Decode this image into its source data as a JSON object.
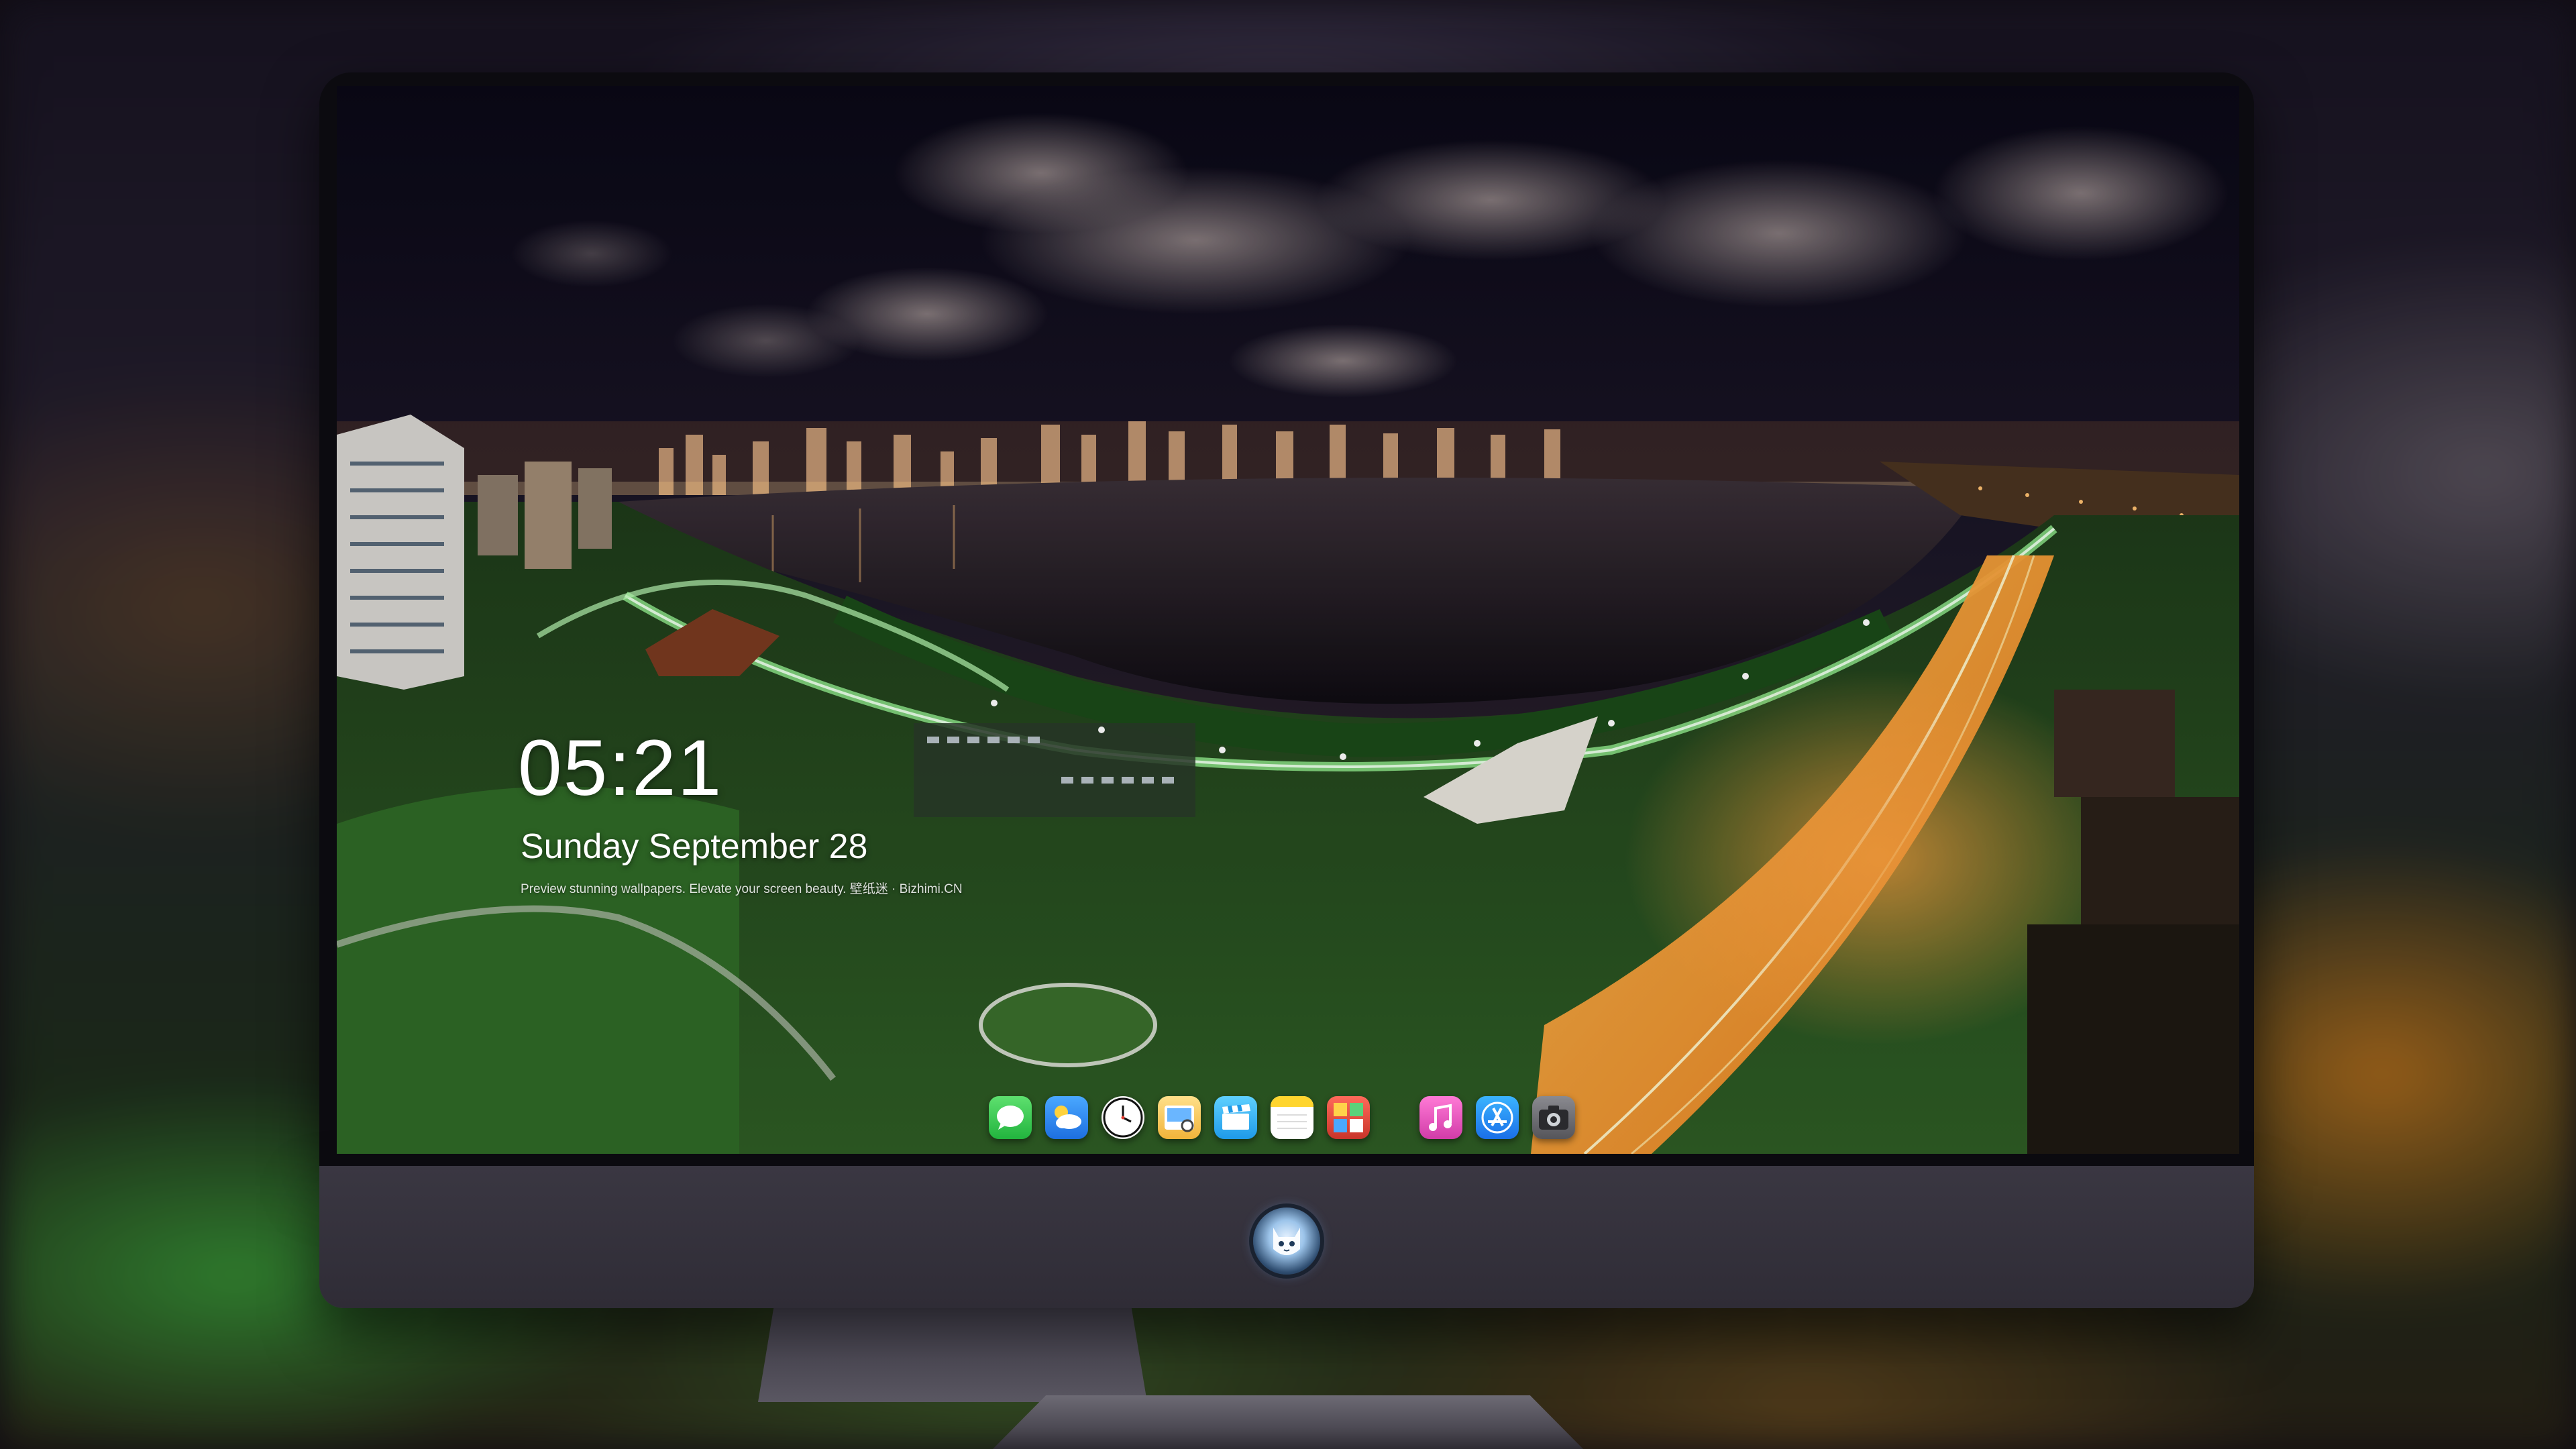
{
  "lock_screen": {
    "time": "05:21",
    "date": "Sunday September  28",
    "caption": "Preview stunning wallpapers. Elevate your screen beauty. 壁纸迷 · Bizhimi.CN"
  },
  "dock": {
    "items": [
      {
        "name": "Messages",
        "icon": "messages-icon",
        "color": "#34c759"
      },
      {
        "name": "Weather",
        "icon": "weather-icon",
        "color": "#2f8cf0"
      },
      {
        "name": "Clock",
        "icon": "clock-icon",
        "color": "#111111"
      },
      {
        "name": "Preview",
        "icon": "preview-icon",
        "color": "#f2c14e"
      },
      {
        "name": "Clips",
        "icon": "clapperboard-icon",
        "color": "#3ab0ff"
      },
      {
        "name": "Notes",
        "icon": "notes-icon",
        "color": "#ffd52e"
      },
      {
        "name": "Photo Booth",
        "icon": "photo-booth-icon",
        "color": "#e94b3c"
      },
      {
        "name": "Music",
        "icon": "music-icon",
        "color": "#fa57c1"
      },
      {
        "name": "App Store",
        "icon": "app-store-icon",
        "color": "#1a8cff"
      },
      {
        "name": "Camera",
        "icon": "camera-icon",
        "color": "#6e6e73"
      }
    ]
  },
  "monitor": {
    "logo": "cat-mascot-logo",
    "bezel_color": "#0c0b10",
    "chin_color": "#35323c"
  }
}
